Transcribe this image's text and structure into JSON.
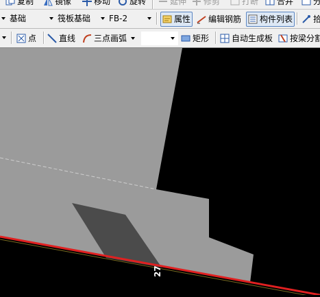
{
  "toolbar_edit": {
    "copy": "复制",
    "mirror": "镜像",
    "move": "移动",
    "rotate": "旋转",
    "extend": "延伸",
    "trim": "修剪",
    "break": "打断",
    "merge": "合并",
    "split": "分"
  },
  "toolbar_component": {
    "floor_value": "基础",
    "type_value": "筏板基础",
    "name_value": "FB-2",
    "properties": "属性",
    "edit_rebar": "编辑钢筋",
    "component_list": "构件列表",
    "pick": "拾"
  },
  "toolbar_draw": {
    "point": "点",
    "line": "直线",
    "three_point_arc": "三点画弧",
    "rect": "矩形",
    "auto_generate": "自动生成板",
    "split_by_beam": "按梁分割"
  },
  "canvas": {
    "dimension_label": "27",
    "colors": {
      "background": "#000000",
      "slab": "#9b9b9b",
      "opening": "#4b4b4b",
      "edge": "#e02020"
    }
  }
}
